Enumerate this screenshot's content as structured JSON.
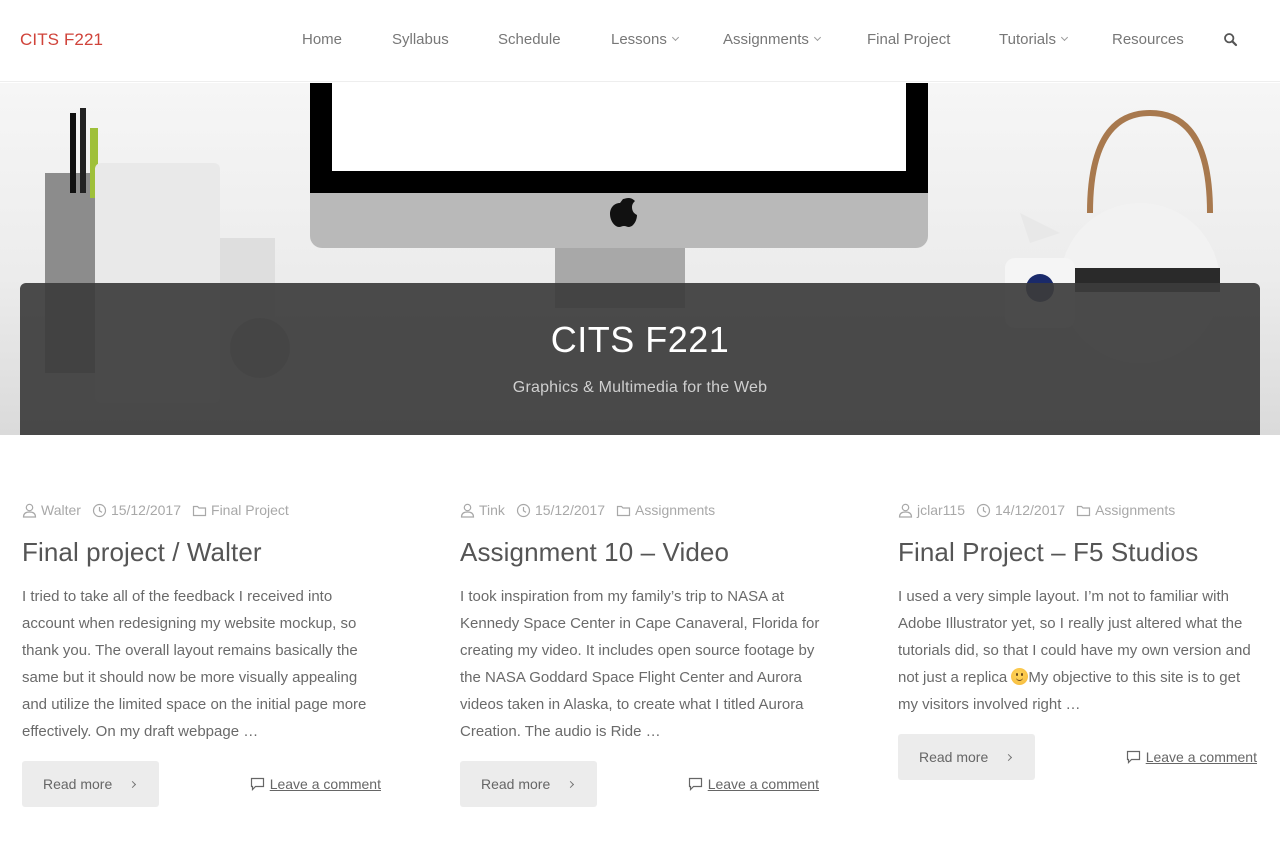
{
  "site": {
    "logo": "CITS F221",
    "brand_color": "#d0433a"
  },
  "nav": {
    "items": [
      {
        "label": "Home",
        "has_dropdown": false
      },
      {
        "label": "Syllabus",
        "has_dropdown": false
      },
      {
        "label": "Schedule",
        "has_dropdown": false
      },
      {
        "label": "Lessons",
        "has_dropdown": true
      },
      {
        "label": "Assignments",
        "has_dropdown": true
      },
      {
        "label": "Final Project",
        "has_dropdown": false
      },
      {
        "label": "Tutorials",
        "has_dropdown": true
      },
      {
        "label": "Resources",
        "has_dropdown": false
      }
    ],
    "search_icon": "search-icon"
  },
  "hero": {
    "title": "CITS F221",
    "subtitle": "Graphics & Multimedia for the Web",
    "overlay_color": "#3c3c3c"
  },
  "posts": [
    {
      "author": "Walter",
      "date": "15/12/2017",
      "category": "Final Project",
      "title": "Final project / Walter",
      "excerpt": "I tried to take all of the feedback I received into account when redesigning my website mockup, so thank you. The overall layout remains basically the same but it should now be more visually appealing and utilize the limited space on the initial page more effectively. On my draft webpage …",
      "read_more": "Read more",
      "comment": "Leave a comment"
    },
    {
      "author": "Tink",
      "date": "15/12/2017",
      "category": "Assignments",
      "title": "Assignment 10 – Video",
      "excerpt": "I took inspiration from my family’s trip to NASA at Kennedy Space Center in Cape Canaveral, Florida for creating my video. It includes open source footage by the NASA Goddard Space Flight Center and Aurora videos taken in Alaska, to create what I titled Aurora Creation. The audio is Ride …",
      "read_more": "Read more",
      "comment": "Leave a comment"
    },
    {
      "author": "jclar115",
      "date": "14/12/2017",
      "category": "Assignments",
      "title": "Final Project – F5 Studios",
      "excerpt_before": "I used a very simple layout.   I’m not to familiar with Adobe Illustrator yet, so I really just altered what the tutorials did, so that I could have my own version and not just a replica ",
      "excerpt_emoji": "slightly-smiling-face",
      "excerpt_after": "My objective to this site is to get my visitors involved right …",
      "read_more": "Read more",
      "comment": "Leave a comment"
    }
  ]
}
